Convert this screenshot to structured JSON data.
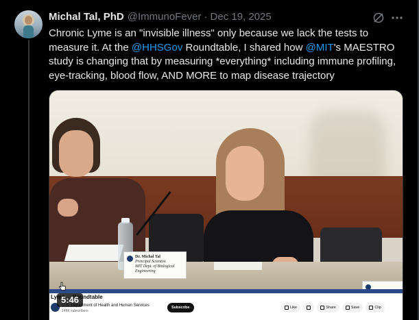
{
  "post": {
    "author_name": "Michal Tal, PhD",
    "author_handle": "@ImmunoFever",
    "separator": "·",
    "date": "Dec 19, 2025",
    "text_parts": {
      "p1": "Chronic Lyme is an \"invisible illness\" only because we lack the tests to measure it.  At the ",
      "m1": "@HHSGov",
      "p2": " Roundtable, I shared how ",
      "m2": "@MIT",
      "p3": "'s MAESTRO study is changing that by measuring *everything* including immune profiling, eye-tracking, blood flow, AND MORE to map disease trajectory"
    },
    "icons": {
      "grok": "grok-icon",
      "more": "more-icon"
    },
    "mention_color": "#1d9bf0"
  },
  "video": {
    "nameplate_name": "Dr. Michal Tal",
    "nameplate_title": "Principal Scientist",
    "nameplate_org": "MIT Dept. of Biological Engineering",
    "yt_title": "Lyme ... Roundtable",
    "yt_channel": "U.S. Department of Health and Human Services",
    "yt_subscribers": "149K subscribers",
    "yt_subscribe": "Subscribe",
    "actions": {
      "like": "Like",
      "share": "Share",
      "save": "Save",
      "clip": "Clip"
    },
    "timestamp": "5:46"
  }
}
